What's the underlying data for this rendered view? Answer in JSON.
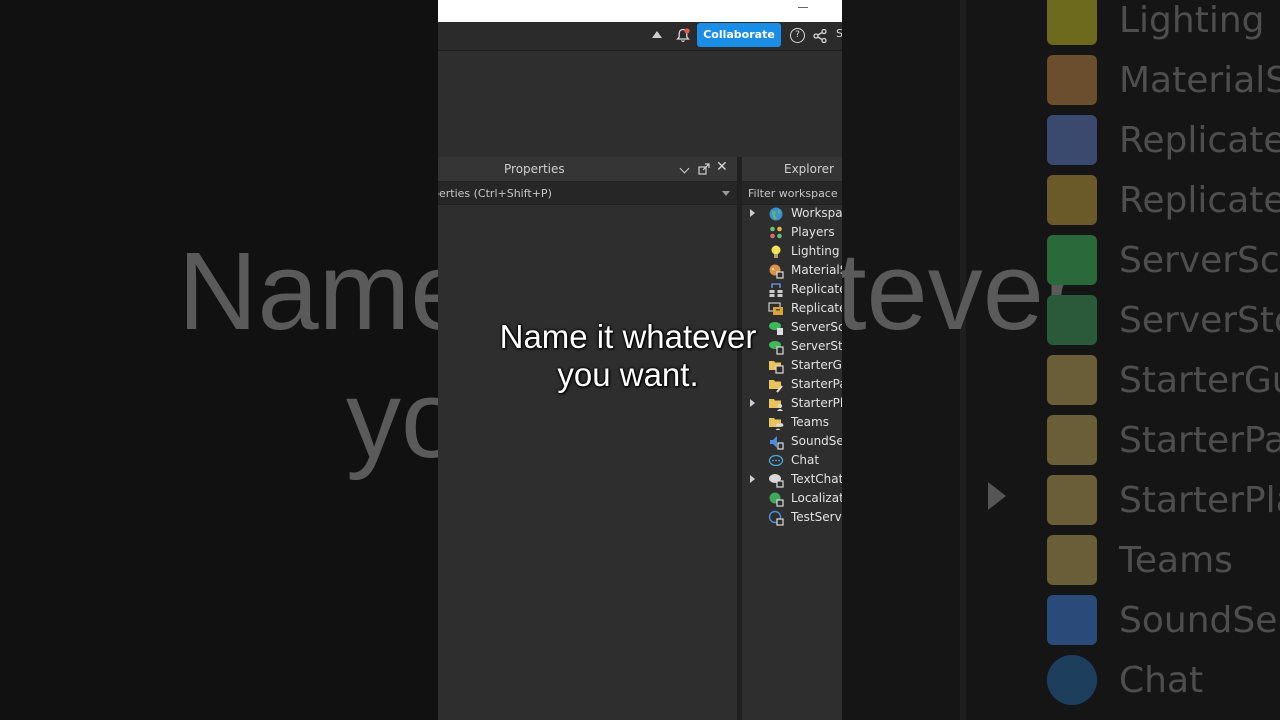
{
  "toolbar": {
    "collaborate_label": "Collaborate",
    "help_glyph": "?",
    "cut_label": "S"
  },
  "properties": {
    "title": "Properties",
    "filter_placeholder": "perties (Ctrl+Shift+P)",
    "close_glyph": "✕"
  },
  "explorer": {
    "title": "Explorer",
    "filter_placeholder": "Filter workspace (",
    "items": [
      {
        "label": "Workspac",
        "icon": "globe-icon",
        "expandable": true
      },
      {
        "label": "Players",
        "icon": "players-icon",
        "expandable": false
      },
      {
        "label": "Lighting",
        "icon": "lightbulb-icon",
        "expandable": false
      },
      {
        "label": "MaterialS",
        "icon": "material-service-icon",
        "expandable": false
      },
      {
        "label": "Replicate",
        "icon": "replicated-first-icon",
        "expandable": false
      },
      {
        "label": "Replicate",
        "icon": "replicated-storage-icon",
        "expandable": false
      },
      {
        "label": "ServerScri",
        "icon": "server-script-service-icon",
        "expandable": false
      },
      {
        "label": "ServerSto",
        "icon": "server-storage-icon",
        "expandable": false
      },
      {
        "label": "StarterGu",
        "icon": "starter-gui-icon",
        "expandable": false
      },
      {
        "label": "StarterPac",
        "icon": "starter-pack-icon",
        "expandable": false
      },
      {
        "label": "StarterPla",
        "icon": "starter-player-icon",
        "expandable": true
      },
      {
        "label": "Teams",
        "icon": "teams-icon",
        "expandable": false
      },
      {
        "label": "SoundSer",
        "icon": "sound-service-icon",
        "expandable": false
      },
      {
        "label": "Chat",
        "icon": "chat-icon",
        "expandable": false
      },
      {
        "label": "TextChatS",
        "icon": "text-chat-service-icon",
        "expandable": true
      },
      {
        "label": "Localizati",
        "icon": "localization-service-icon",
        "expandable": false
      },
      {
        "label": "TestServic",
        "icon": "test-service-icon",
        "expandable": false
      }
    ]
  },
  "caption": {
    "line1": "Name it whatever",
    "line2": "you want."
  },
  "background_left": {
    "line1": "Name",
    "line2": "yo"
  },
  "background_right": {
    "big_text": "tever",
    "items": [
      "Lighting",
      "MaterialS",
      "Replicate",
      "Replicate",
      "ServerScri",
      "ServerSto",
      "StarterGu",
      "StarterPa",
      "StarterPla",
      "Teams",
      "SoundSe",
      "Chat"
    ]
  },
  "colors": {
    "accent": "#1a8ee6",
    "panel": "#2e2e2e",
    "text": "#e2e2e2"
  }
}
